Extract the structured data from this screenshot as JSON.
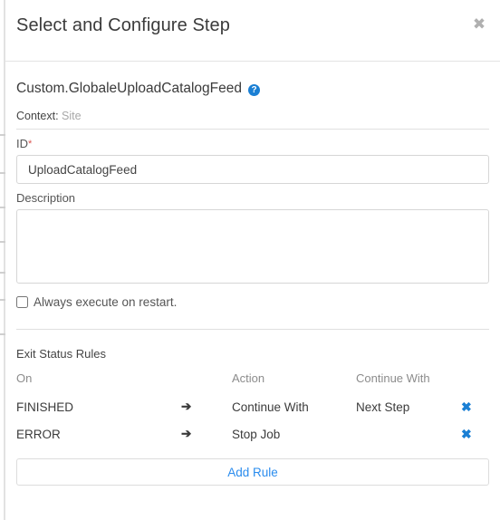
{
  "header": {
    "title": "Select and Configure Step",
    "close_label": "✖"
  },
  "step": {
    "name": "Custom.GlobaleUploadCatalogFeed",
    "help_glyph": "?",
    "context_label": "Context:",
    "context_value": "Site"
  },
  "form": {
    "id_label": "ID",
    "id_required_marker": "*",
    "id_value": "UploadCatalogFeed",
    "id_placeholder": "",
    "description_label": "Description",
    "description_value": "",
    "description_placeholder": "",
    "restart_checkbox_label": "Always execute on restart.",
    "restart_checked": false
  },
  "rules": {
    "section_title": "Exit Status Rules",
    "columns": [
      "On",
      "Action",
      "Continue With"
    ],
    "arrow_glyph": "➔",
    "delete_glyph": "✖",
    "rows": [
      {
        "on": "FINISHED",
        "action": "Continue With",
        "continue_with": "Next Step"
      },
      {
        "on": "ERROR",
        "action": "Stop Job",
        "continue_with": ""
      }
    ],
    "add_rule_label": "Add Rule"
  },
  "colors": {
    "accent": "#1a7fd4",
    "link": "#2a8cee",
    "required": "#d9534f",
    "text": "#3b3b3b",
    "muted": "#8c8c8c"
  }
}
